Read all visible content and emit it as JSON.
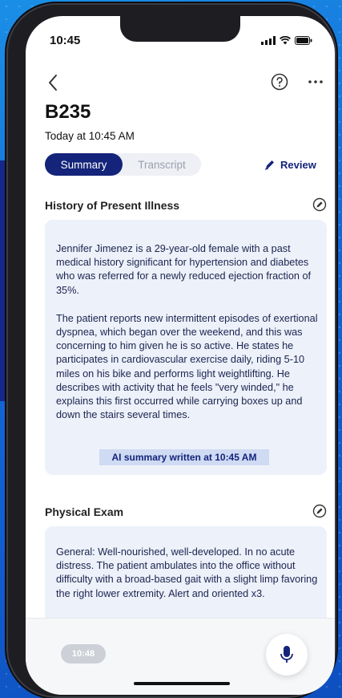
{
  "status_bar": {
    "time": "10:45"
  },
  "header": {
    "title": "B235",
    "subtitle": "Today at 10:45 AM"
  },
  "tabs": [
    {
      "label": "Summary",
      "selected": true
    },
    {
      "label": "Transcript",
      "selected": false
    }
  ],
  "review_label": "Review",
  "sections": [
    {
      "title": "History of Present Illness",
      "paragraphs": [
        "Jennifer Jimenez is a 29-year-old female with a past medical history significant for hypertension and diabetes who was referred for a newly reduced ejection fraction of 35%.",
        "The patient reports new intermittent episodes of exertional dyspnea, which began over the weekend, and this was concerning to him given he is so active. He states he participates in cardiovascular exercise daily, riding 5-10 miles on his bike and performs light weightlifting. He describes with activity that he feels \"very winded,\" he explains this first occurred while carrying boxes up and down the stairs several times."
      ],
      "ai_badge": "AI summary written at 10:45 AM"
    },
    {
      "title": "Physical Exam",
      "paragraphs": [
        "General: Well-nourished, well-developed. In no acute distress. The patient ambulates into the office without difficulty with a broad-based gait with a slight limp favoring the right lower extremity. Alert and oriented x3."
      ]
    }
  ],
  "recording": {
    "timer": "10:48"
  },
  "colors": {
    "accent": "#14247a",
    "card_bg": "#edf1f9",
    "badge_bg": "#cfdaf3"
  },
  "icons": [
    "back-chevron-icon",
    "help-icon",
    "more-icon",
    "pen-icon",
    "edit-icon",
    "mic-icon"
  ]
}
